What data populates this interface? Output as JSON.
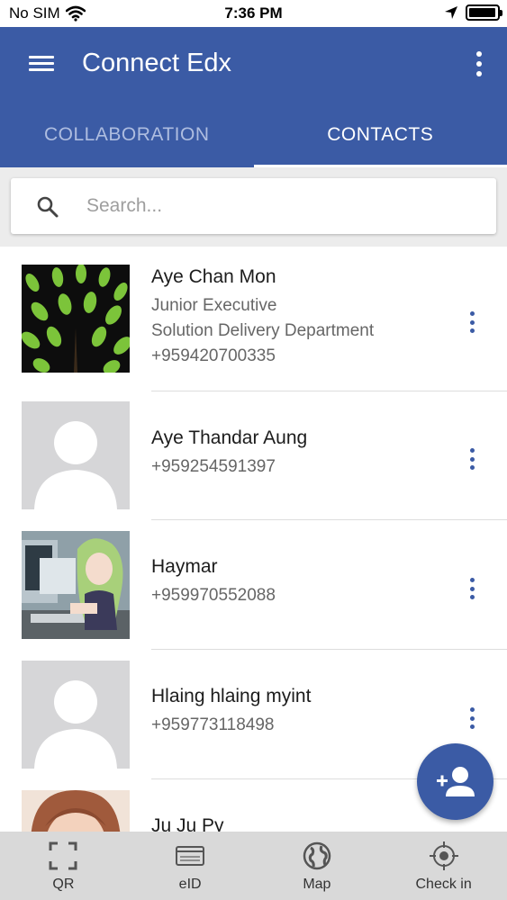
{
  "status_bar": {
    "carrier": "No SIM",
    "time": "7:36 PM",
    "battery_level": 0.95
  },
  "app_bar": {
    "title": "Connect Edx",
    "color": "#3b5ba5"
  },
  "tabs": [
    {
      "label": "COLLABORATION",
      "active": false
    },
    {
      "label": "CONTACTS",
      "active": true
    }
  ],
  "search": {
    "placeholder": "Search..."
  },
  "contacts": [
    {
      "name": "Aye Chan Mon",
      "title": "Junior Executive",
      "department": "Solution Delivery Department",
      "phone": "+959420700335",
      "avatar": "tree-image"
    },
    {
      "name": "Aye Thandar Aung",
      "phone": "+959254591397",
      "avatar": "default-person"
    },
    {
      "name": "Haymar",
      "phone": "+959970552088",
      "avatar": "anime-girl-image"
    },
    {
      "name": "Hlaing hlaing myint",
      "phone": "+959773118498",
      "avatar": "default-person"
    },
    {
      "name": "Ju Ju Py",
      "avatar": "woman-portrait-image"
    }
  ],
  "fab": {
    "icon": "add-person-icon"
  },
  "bottom_nav": [
    {
      "label": "QR",
      "icon": "qr-scan-icon"
    },
    {
      "label": "eID",
      "icon": "id-card-icon"
    },
    {
      "label": "Map",
      "icon": "globe-icon"
    },
    {
      "label": "Check in",
      "icon": "crosshair-icon"
    }
  ]
}
